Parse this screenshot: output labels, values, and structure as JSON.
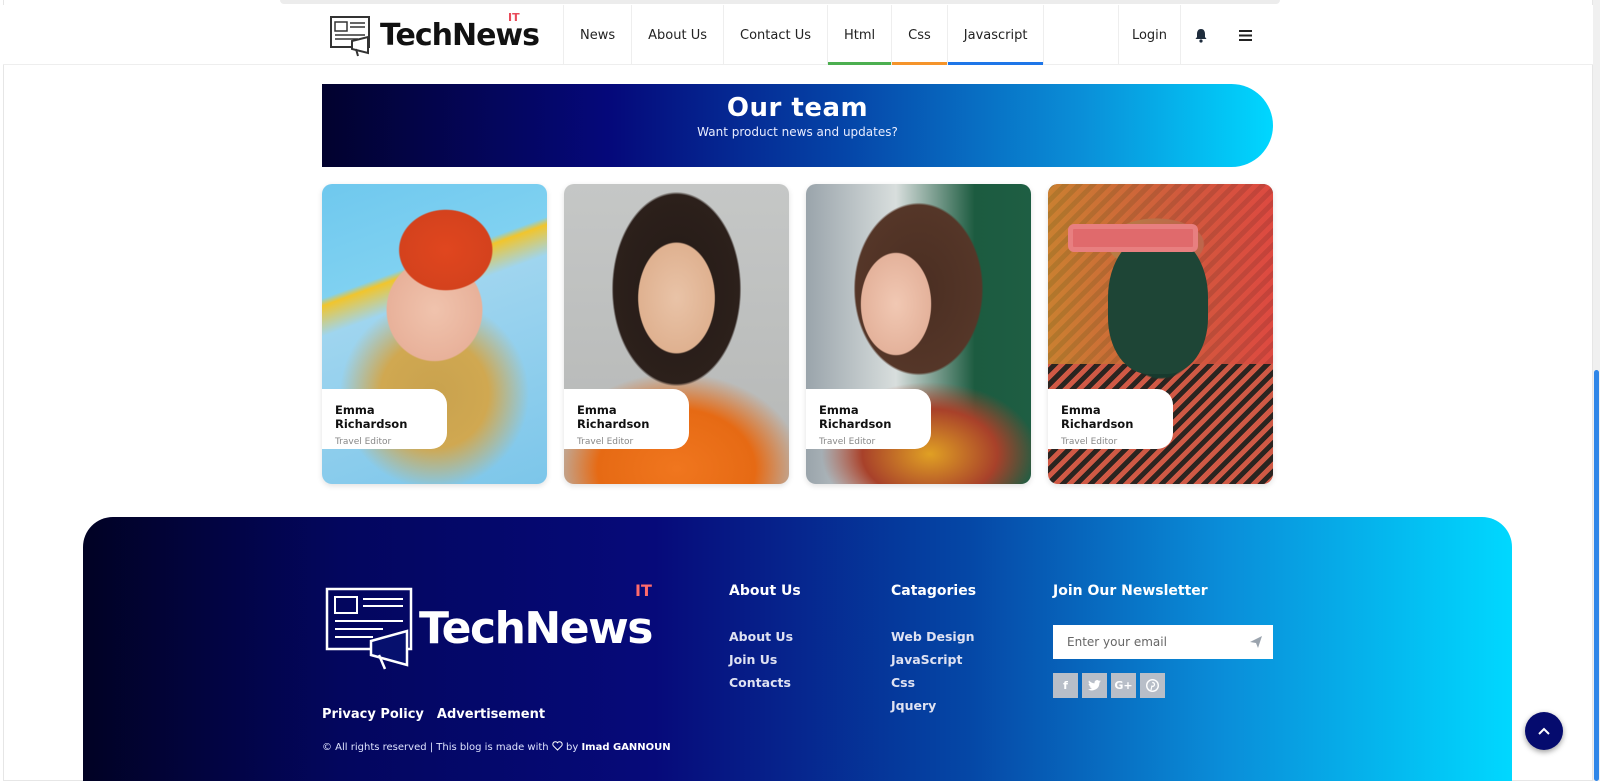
{
  "header": {
    "logo": {
      "text": "TechNews",
      "sup": "IT"
    },
    "nav": [
      {
        "label": "News",
        "bar": ""
      },
      {
        "label": "About Us",
        "bar": ""
      },
      {
        "label": "Contact Us",
        "bar": ""
      },
      {
        "label": "Html",
        "bar": "#4caf50"
      },
      {
        "label": "Css",
        "bar": "#f5942a"
      },
      {
        "label": "Javascript",
        "bar": "#1e76e8"
      }
    ],
    "login_label": "Login",
    "icons": {
      "bell": "bell-icon",
      "menu": "menu-icon"
    }
  },
  "team": {
    "title": "Our team",
    "subtitle": "Want product news and updates?",
    "members": [
      {
        "name": "Emma Richardson",
        "role": "Travel Editor"
      },
      {
        "name": "Emma Richardson",
        "role": "Travel Editor"
      },
      {
        "name": "Emma Richardson",
        "role": "Travel Editor"
      },
      {
        "name": "Emma Richardson",
        "role": "Travel Editor"
      }
    ]
  },
  "footer": {
    "logo": {
      "text": "TechNews",
      "sup": "IT"
    },
    "links": [
      "Privacy Policy",
      "Advertisement"
    ],
    "copyright_prefix": "© All rights reserved | This blog is made with",
    "copyright_by": "by",
    "copyright_author": "Imad GANNOUN",
    "about": {
      "title": "About Us",
      "items": [
        "About Us",
        "Join Us",
        "Contacts"
      ]
    },
    "categories": {
      "title": "Catagories",
      "items": [
        "Web Design",
        "JavaScript",
        "Css",
        "Jquery"
      ]
    },
    "newsletter": {
      "title": "Join Our Newsletter",
      "placeholder": "Enter your email"
    },
    "socials": [
      "f",
      "t",
      "G+",
      "p"
    ]
  },
  "colors": {
    "accent_red": "#e94b5a",
    "html_bar": "#4caf50",
    "css_bar": "#f5942a",
    "js_bar": "#1e76e8",
    "footer_dark": "#02022e",
    "footer_light": "#00d8ff"
  }
}
